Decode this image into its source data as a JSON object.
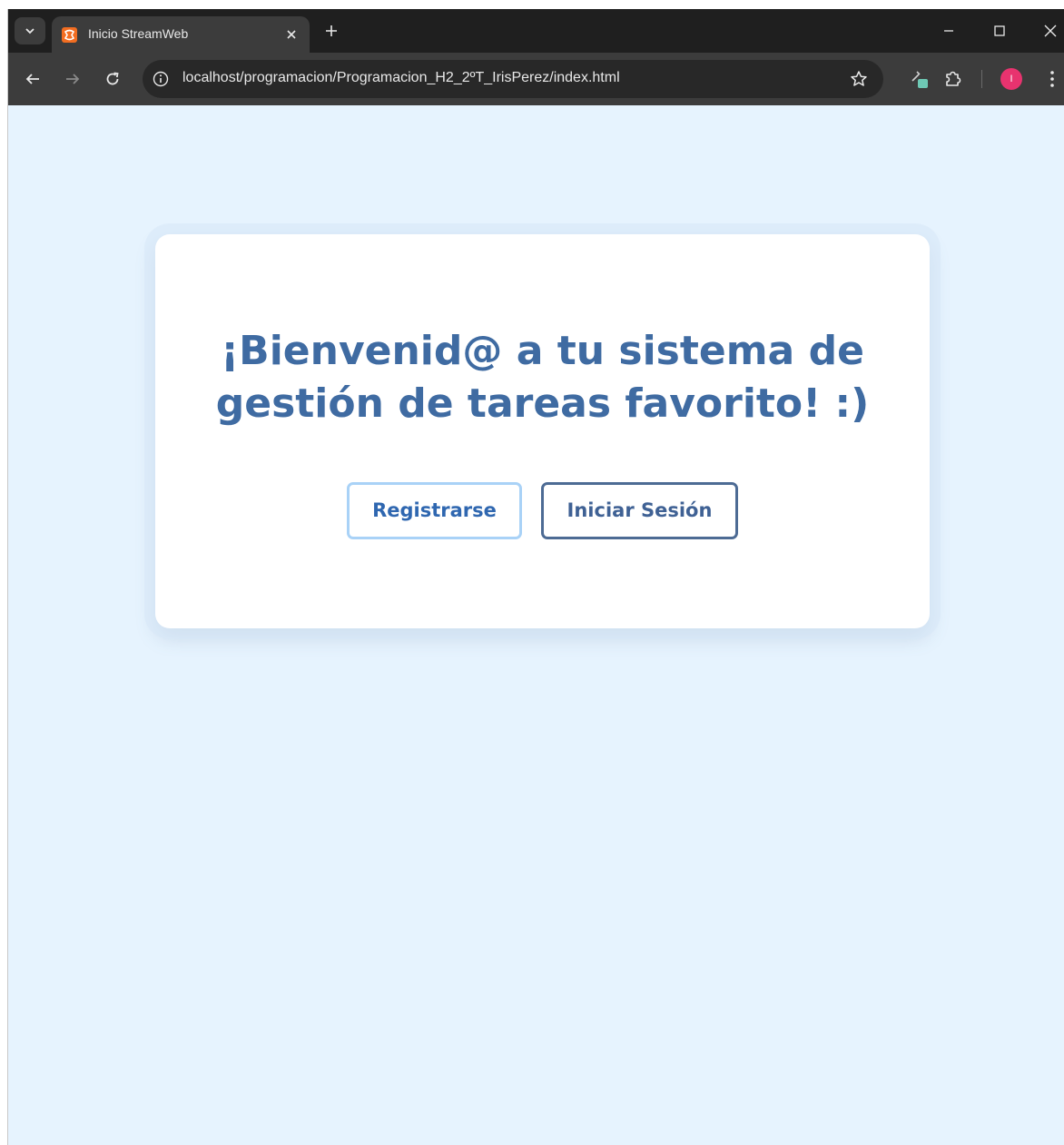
{
  "browser": {
    "tab": {
      "favicon_text": "XAMPP-icon",
      "title": "Inicio StreamWeb"
    },
    "address_bar": {
      "url": "localhost/programacion/Programacion_H2_2ºT_IrisPerez/index.html"
    },
    "profile_initial": "I",
    "colors": {
      "tabstrip": "#1f1f1f",
      "toolbar": "#3c3c3c",
      "omnibox": "#282828",
      "profile_avatar": "#e8336f",
      "favicon": "#f26d21"
    }
  },
  "page": {
    "headline": "¡Bienvenid@ a tu sistema de gestión de tareas favorito! :)",
    "buttons": {
      "register_label": "Registrarse",
      "login_label": "Iniciar Sesión"
    },
    "colors": {
      "background": "#e6f3fe",
      "card": "#ffffff",
      "headline": "#3f6ba2",
      "register_border": "#a9d2f7",
      "login_border": "#4d6b94"
    }
  }
}
